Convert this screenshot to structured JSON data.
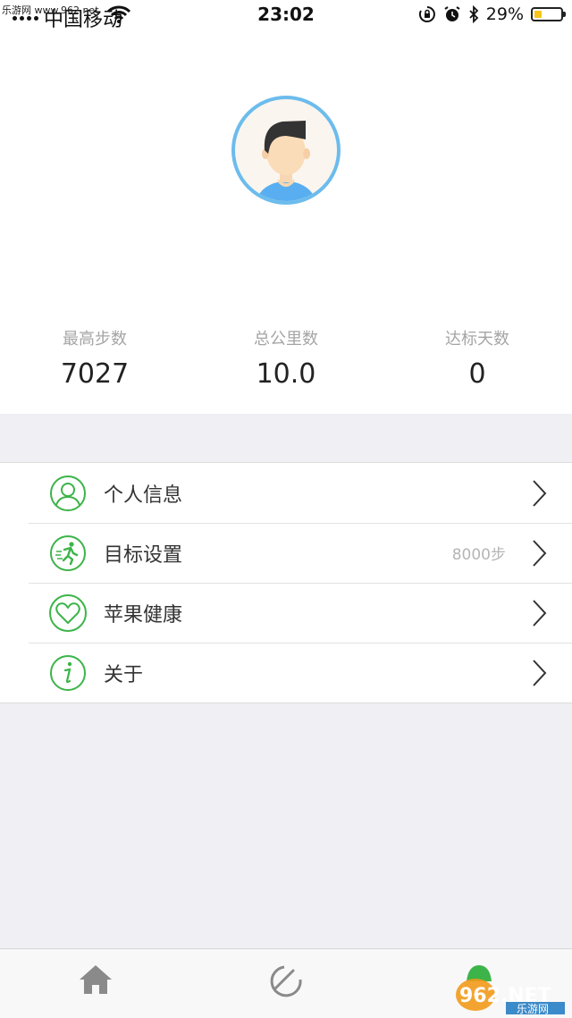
{
  "status_bar": {
    "watermark": "乐游网 www.962.net",
    "carrier": "中国移动",
    "time": "23:02",
    "battery_percent": "29%",
    "battery_level": 0.29,
    "battery_color": "#f5c518",
    "icons": [
      "signal-icon",
      "wifi-icon",
      "orientation-lock-icon",
      "alarm-icon",
      "bluetooth-icon",
      "battery-icon"
    ]
  },
  "profile": {
    "avatar_icon": "user-avatar",
    "ring_color": "#6cbcec"
  },
  "stats": [
    {
      "label": "最高步数",
      "value": "7027"
    },
    {
      "label": "总公里数",
      "value": "10.0"
    },
    {
      "label": "达标天数",
      "value": "0"
    }
  ],
  "menu": {
    "accent_color": "#3cb449",
    "items": [
      {
        "label": "个人信息",
        "icon": "person-icon",
        "value": ""
      },
      {
        "label": "目标设置",
        "icon": "running-icon",
        "value": "8000步"
      },
      {
        "label": "苹果健康",
        "icon": "heart-icon",
        "value": ""
      },
      {
        "label": "关于",
        "icon": "info-icon",
        "value": ""
      }
    ]
  },
  "tab_bar": {
    "tabs": [
      {
        "icon": "home-icon"
      },
      {
        "icon": "sport-ring-icon"
      },
      {
        "icon": "profile-tab-icon"
      }
    ]
  },
  "watermark": {
    "brand": "962.NET",
    "sub": "乐游网"
  }
}
